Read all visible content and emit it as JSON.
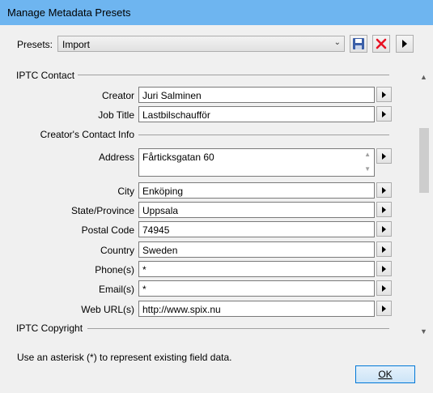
{
  "window": {
    "title": "Manage Metadata Presets"
  },
  "presets": {
    "label": "Presets:",
    "selected": "Import"
  },
  "toolbar": {
    "save_icon": "floppy-disk-icon",
    "delete_icon": "red-x-icon",
    "menu_icon": "play-arrow-icon"
  },
  "sections": {
    "iptc_contact": "IPTC Contact",
    "creator_contact_info": "Creator's Contact Info",
    "iptc_copyright": "IPTC Copyright"
  },
  "fields": {
    "creator": {
      "label": "Creator",
      "value": "Juri Salminen"
    },
    "job_title": {
      "label": "Job Title",
      "value": "Lastbilschaufför"
    },
    "address": {
      "label": "Address",
      "value": "Fårticksgatan 60"
    },
    "city": {
      "label": "City",
      "value": "Enköping"
    },
    "state": {
      "label": "State/Province",
      "value": "Uppsala"
    },
    "postal_code": {
      "label": "Postal Code",
      "value": "74945"
    },
    "country": {
      "label": "Country",
      "value": "Sweden"
    },
    "phone": {
      "label": "Phone(s)",
      "value": "*"
    },
    "email": {
      "label": "Email(s)",
      "value": "*"
    },
    "web_url": {
      "label": "Web URL(s)",
      "value": "http://www.spix.nu"
    }
  },
  "hint": "Use an asterisk (*) to represent existing field data.",
  "ok_label": "OK",
  "colors": {
    "titlebar": "#6eb5f0",
    "delete": "#e81123",
    "save": "#3b5fa8"
  }
}
